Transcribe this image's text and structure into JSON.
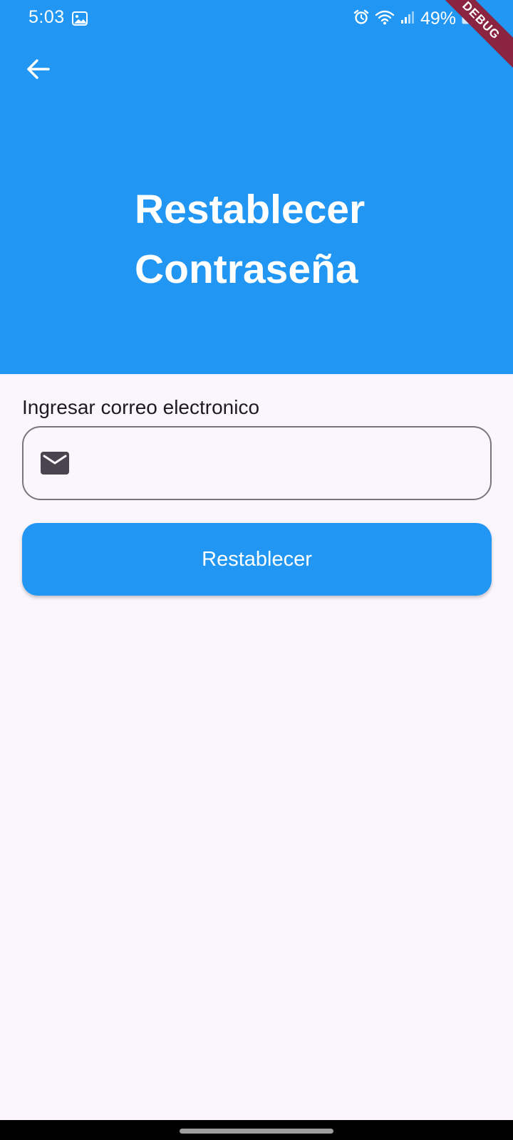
{
  "status_bar": {
    "time": "5:03",
    "battery": "49%",
    "icons": [
      "gallery-icon",
      "alarm-icon",
      "wifi-icon",
      "signal-icon",
      "battery-icon"
    ]
  },
  "debug_banner": "DEBUG",
  "header": {
    "title": "Restablecer\nContraseña",
    "back_icon": "arrow-back-icon",
    "background_color": "#2196f3"
  },
  "form": {
    "email_label": "Ingresar correo electronico",
    "email_value": "",
    "email_icon": "mail-icon",
    "submit_label": "Restablecer"
  },
  "colors": {
    "primary": "#2196f3",
    "background": "#fbf6fe",
    "outline": "#79747e",
    "debug": "#8b2440"
  }
}
